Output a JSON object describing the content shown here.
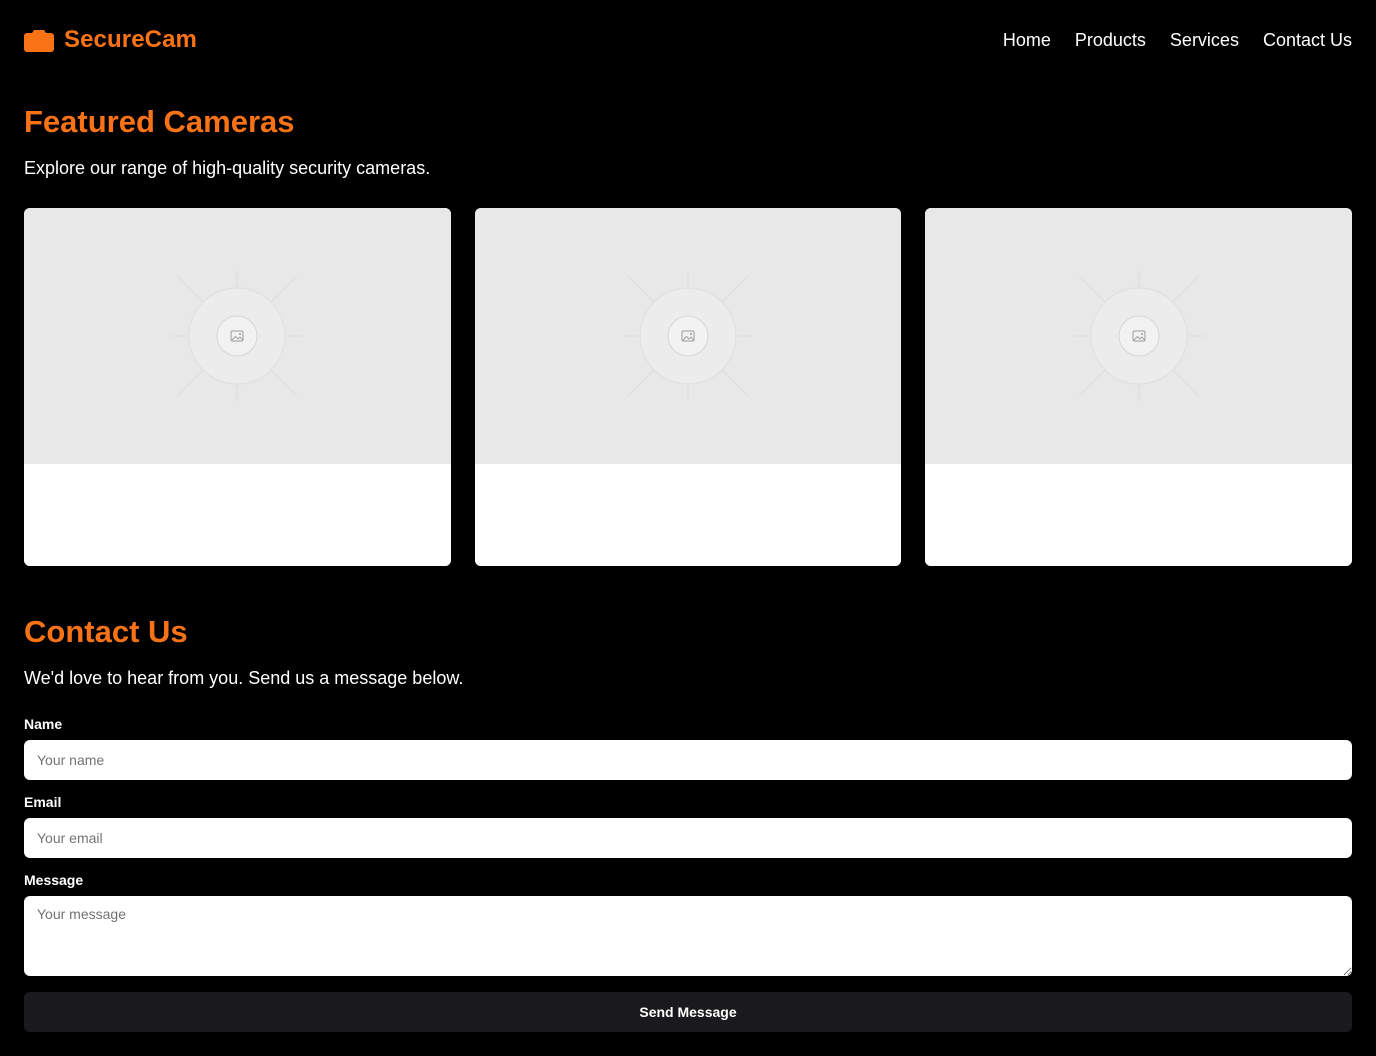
{
  "brand": {
    "name": "SecureCam",
    "icon": "camera-icon",
    "accent_color": "#f97316"
  },
  "nav": {
    "items": [
      {
        "label": "Home"
      },
      {
        "label": "Products"
      },
      {
        "label": "Services"
      },
      {
        "label": "Contact Us"
      }
    ]
  },
  "featured": {
    "title": "Featured Cameras",
    "subtitle": "Explore our range of high-quality security cameras.",
    "cards": [
      {
        "image_icon": "image-placeholder-icon"
      },
      {
        "image_icon": "image-placeholder-icon"
      },
      {
        "image_icon": "image-placeholder-icon"
      }
    ]
  },
  "contact": {
    "title": "Contact Us",
    "subtitle": "We'd love to hear from you. Send us a message below.",
    "name_label": "Name",
    "name_placeholder": "Your name",
    "email_label": "Email",
    "email_placeholder": "Your email",
    "message_label": "Message",
    "message_placeholder": "Your message",
    "submit_label": "Send Message"
  }
}
